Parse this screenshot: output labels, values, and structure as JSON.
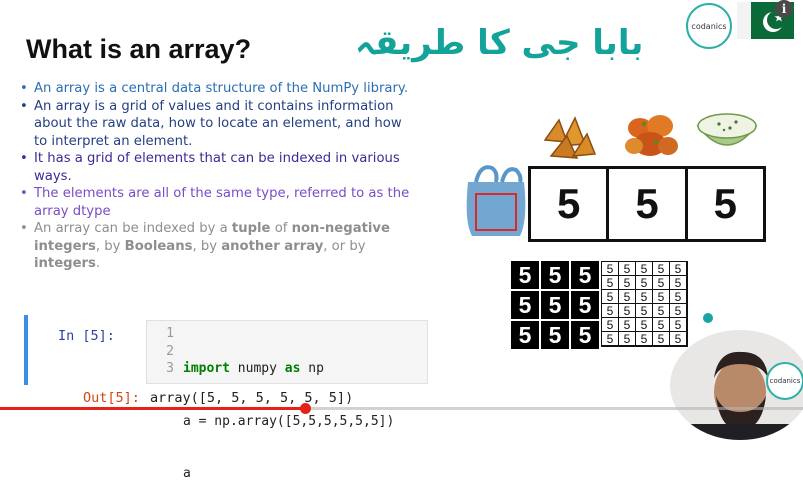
{
  "slide": {
    "title": "What is an array?",
    "urdu_heading": "بابا جی کا طریقہ",
    "bullets": [
      {
        "color": "#2a6fb3",
        "text": "An array is a central data structure of the NumPy library."
      },
      {
        "color": "#243f82",
        "text": "An array is a grid of values and it contains information about the raw data, how to locate an element, and how to interpret an element."
      },
      {
        "color": "#3c2a96",
        "text": "It has a grid of elements that can be indexed in various ways."
      },
      {
        "color": "#7a4cc6",
        "text": "The elements are all of the same type, referred to as the array dtype"
      }
    ],
    "bullet5": {
      "color": "#8e8e8e",
      "p1": "An array can be indexed by a ",
      "b1": "tuple",
      "p2": " of ",
      "b2": "non-negative integers",
      "p3": ", by ",
      "b3": "Booleans",
      "p4": ", by ",
      "b4": "another array",
      "p5": ", or by ",
      "b5": "integers",
      "p6": "."
    }
  },
  "notebook": {
    "in_prompt": "In [5]:",
    "line_numbers": [
      "1",
      "2",
      "3"
    ],
    "code_line1_kw1": "import",
    "code_line1_mid": " numpy ",
    "code_line1_kw2": "as",
    "code_line1_end": " np",
    "code_line2": "a = np.array([5,5,5,5,5,5])",
    "code_line3": "a",
    "out_prompt": "Out[5]:",
    "out_text": "array([5, 5, 5, 5, 5, 5])"
  },
  "illustration": {
    "array_values": [
      "5",
      "5",
      "5"
    ],
    "black_grid_value": "5",
    "white_grid_value": "5",
    "black_grid": {
      "rows": 3,
      "cols": 3
    },
    "white_grid": {
      "rows": 6,
      "cols": 5
    }
  },
  "branding": {
    "logo_text": "codanics",
    "logo_subtext": "",
    "info_icon": "i",
    "flag": "pakistan-flag"
  },
  "video": {
    "progress_fraction": 0.38
  },
  "colors": {
    "urdu_heading": "#14a39a",
    "progress": "#e62117",
    "cell_accent": "#3a8ee6",
    "flag_green": "#0b6a37"
  }
}
